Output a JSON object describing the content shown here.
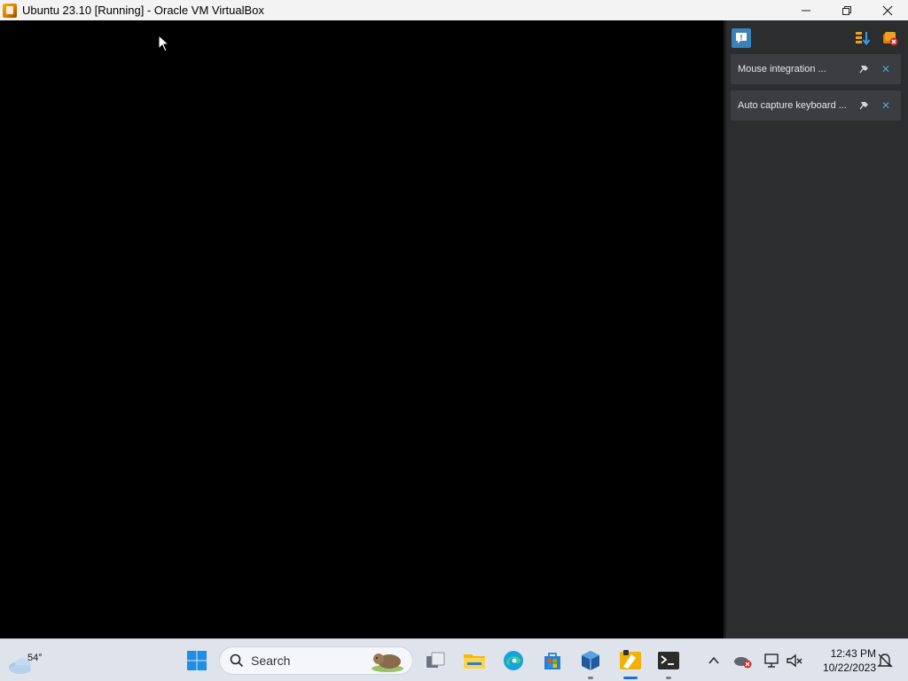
{
  "window": {
    "title": "Ubuntu 23.10 [Running] - Oracle VM VirtualBox",
    "app_icon": "virtualbox-icon",
    "controls": [
      "minimize-icon",
      "restore-icon",
      "close-icon"
    ]
  },
  "side_panel": {
    "toolbar_icons": [
      "notification-center-icon",
      "sort-icon",
      "clear-all-icon"
    ],
    "notifications": [
      {
        "text": "Mouse integration ...",
        "pin_icon": "pin-icon",
        "close_icon": "close-icon"
      },
      {
        "text": "Auto capture keyboard ...",
        "pin_icon": "pin-icon",
        "close_icon": "close-icon"
      }
    ],
    "accent_color": "#4aa3e0"
  },
  "taskbar": {
    "weather_temp": "54°",
    "search_label": "Search",
    "apps": [
      "windows-start-icon",
      "search-icon",
      "task-view-icon",
      "file-explorer-icon",
      "edge-icon",
      "store-icon",
      "virtualbox-manager-icon",
      "virtualbox-vm-icon",
      "terminal-icon"
    ],
    "tray": [
      "show-hidden-icons-chevron",
      "onedrive-error-icon",
      "network-icon",
      "speaker-muted-icon",
      "notifications-icon"
    ],
    "time": "12:43 PM",
    "date": "10/22/2023"
  }
}
